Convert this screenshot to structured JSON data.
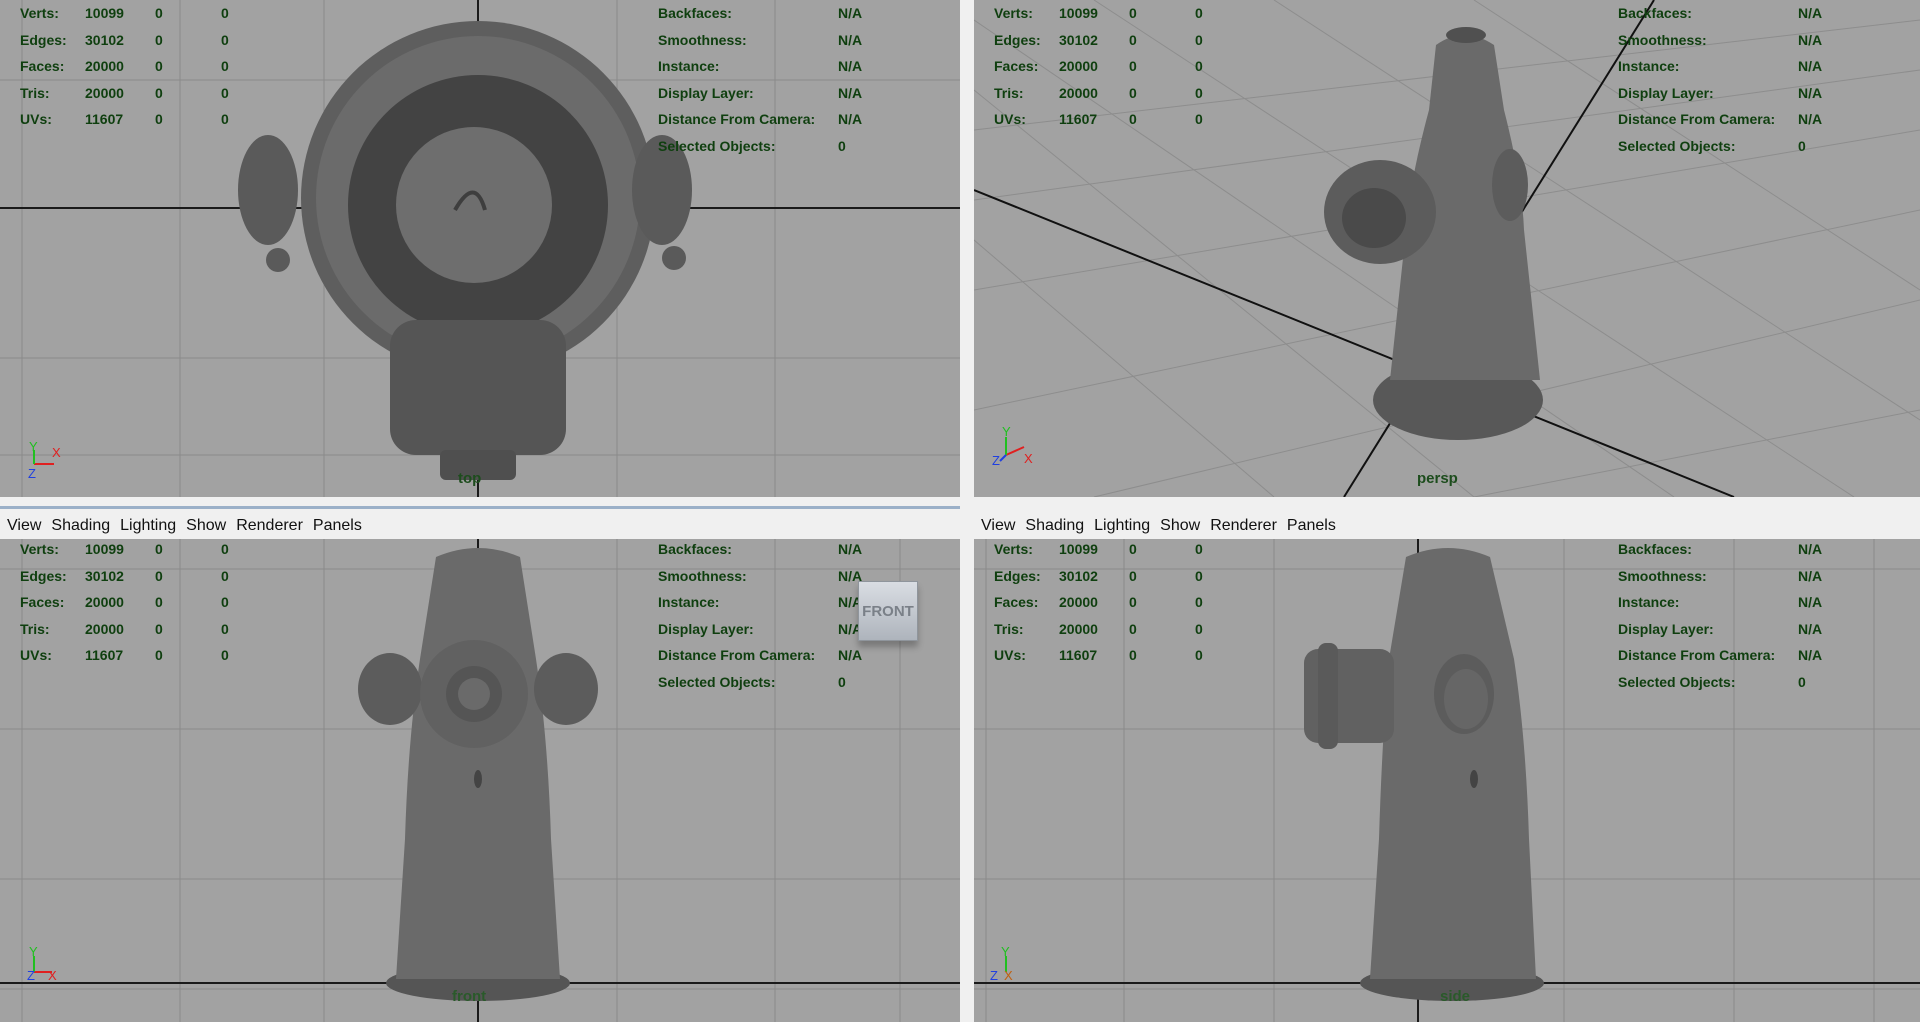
{
  "menu": [
    "View",
    "Shading",
    "Lighting",
    "Show",
    "Renderer",
    "Panels"
  ],
  "hud_left": [
    {
      "label": "Verts:",
      "v1": "10099",
      "v2": "0",
      "v3": "0"
    },
    {
      "label": "Edges:",
      "v1": "30102",
      "v2": "0",
      "v3": "0"
    },
    {
      "label": "Faces:",
      "v1": "20000",
      "v2": "0",
      "v3": "0"
    },
    {
      "label": "Tris:",
      "v1": "20000",
      "v2": "0",
      "v3": "0"
    },
    {
      "label": "UVs:",
      "v1": "11607",
      "v2": "0",
      "v3": "0"
    }
  ],
  "hud_right": [
    {
      "label": "Backfaces:",
      "value": "N/A"
    },
    {
      "label": "Smoothness:",
      "value": "N/A"
    },
    {
      "label": "Instance:",
      "value": "N/A"
    },
    {
      "label": "Display Layer:",
      "value": "N/A"
    },
    {
      "label": "Distance From Camera:",
      "value": "N/A"
    },
    {
      "label": "Selected Objects:",
      "value": "0"
    }
  ],
  "cameras": {
    "top": "top",
    "persp": "persp",
    "front": "front",
    "side": "side"
  },
  "viewcube_label": "FRONT",
  "axes": {
    "x": "X",
    "y": "Y",
    "z": "Z"
  },
  "colors": {
    "viewport_bg": "#a2a2a2",
    "hud_text": "#0f3f0f",
    "axis_x": "#e02020",
    "axis_y": "#20c020",
    "axis_z": "#2040e0"
  }
}
